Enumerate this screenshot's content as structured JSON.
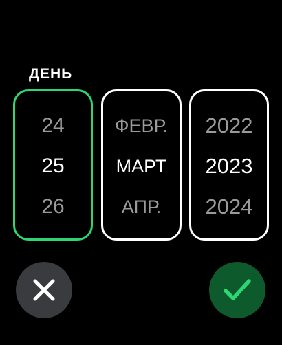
{
  "label": "ДЕНЬ",
  "day": {
    "prev": "24",
    "current": "25",
    "next": "26"
  },
  "month": {
    "prev": "ФЕВР.",
    "current": "МАРТ",
    "next": "АПР."
  },
  "year": {
    "prev": "2022",
    "current": "2023",
    "next": "2024"
  },
  "selected_picker": "day",
  "icons": {
    "cancel": "close-icon",
    "confirm": "checkmark-icon"
  },
  "colors": {
    "background": "#000000",
    "selected_border": "#2ed573",
    "unselected_border": "#ffffff",
    "dim_text": "#9a9a9a",
    "cancel_bg": "#3a3b3e",
    "confirm_bg": "#0d5a2c",
    "confirm_icon": "#2ed573"
  }
}
